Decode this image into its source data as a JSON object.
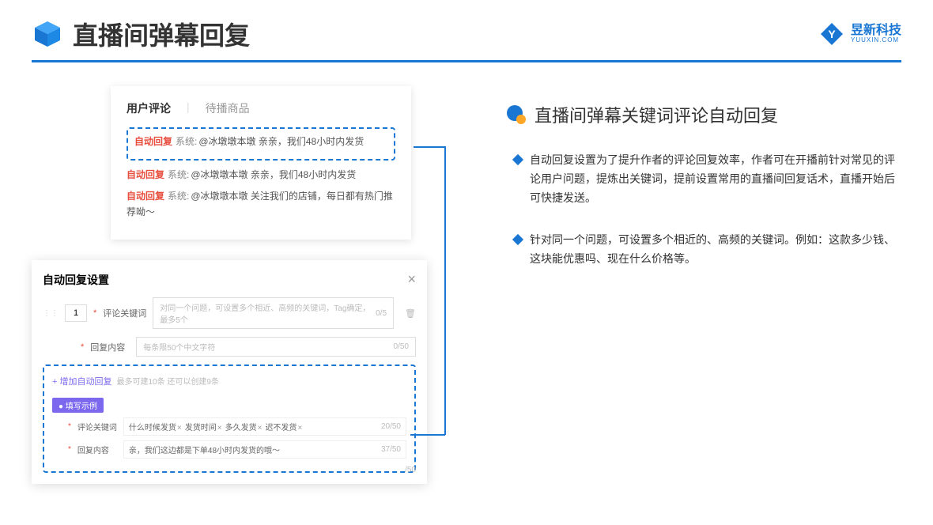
{
  "header": {
    "title": "直播间弹幕回复",
    "brand_cn": "昱新科技",
    "brand_en": "YUUXIN.COM"
  },
  "comment_panel": {
    "tab_user": "用户评论",
    "tab_goods": "待播商品",
    "auto_tag": "自动回复",
    "sys_tag": "系统:",
    "msg1": "@冰墩墩本墩 亲亲，我们48小时内发货",
    "msg2": "@冰墩墩本墩 亲亲，我们48小时内发货",
    "msg3": "@冰墩墩本墩 关注我们的店铺，每日都有热门推荐呦～"
  },
  "settings": {
    "title": "自动回复设置",
    "num": "1",
    "label_keyword": "评论关键词",
    "placeholder_keyword": "对同一个问题，可设置多个相近、高频的关键词，Tag确定，最多5个",
    "count_keyword": "0/5",
    "label_content": "回复内容",
    "placeholder_content": "每条限50个中文字符",
    "count_content": "0/50",
    "add_link": "+ 增加自动回复",
    "add_hint": "最多可建10条 还可以创建9条",
    "example_badge": "● 填写示例",
    "ex_label_keyword": "评论关键词",
    "ex_tags": [
      "什么时候发货",
      "发货时间",
      "多久发货",
      "迟不发货"
    ],
    "ex_count_keyword": "20/50",
    "ex_label_content": "回复内容",
    "ex_content": "亲，我们这边都是下单48小时内发货的哦～",
    "ex_count_content": "37/50",
    "bottom_count": "/50"
  },
  "right": {
    "subtitle": "直播间弹幕关键词评论自动回复",
    "bullet1": "自动回复设置为了提升作者的评论回复效率，作者可在开播前针对常见的评论用户问题，提炼出关键词，提前设置常用的直播间回复话术，直播开始后可快捷发送。",
    "bullet2": "针对同一个问题，可设置多个相近的、高频的关键词。例如：这款多少钱、这块能优惠吗、现在什么价格等。"
  }
}
